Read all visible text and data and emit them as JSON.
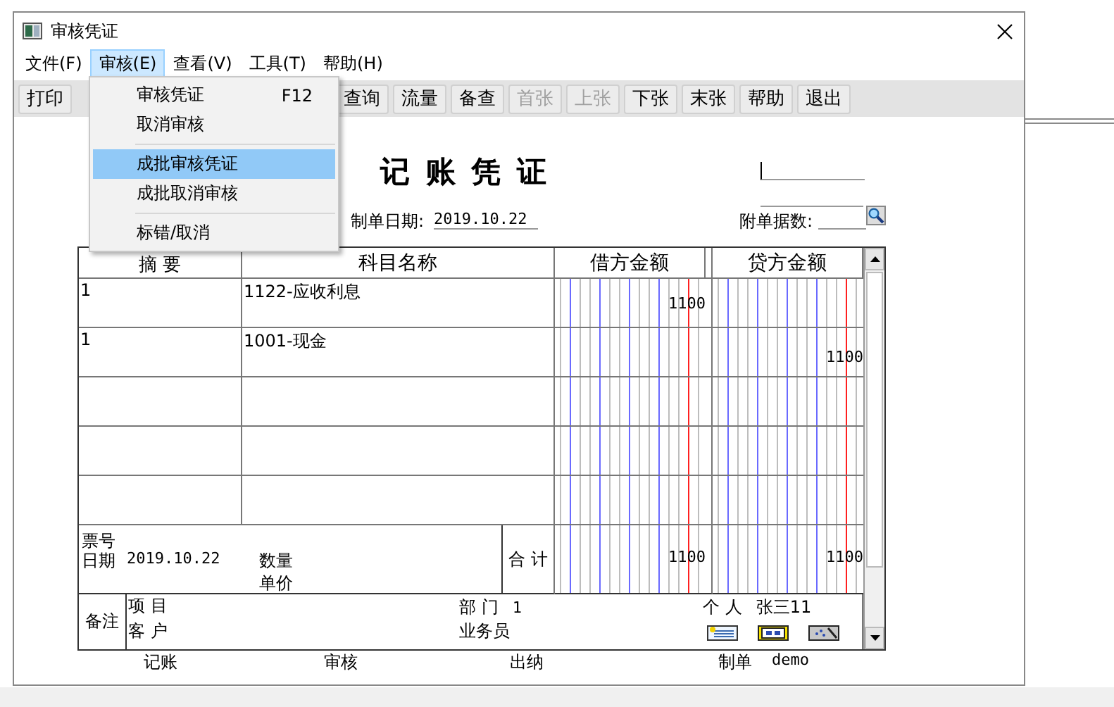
{
  "window": {
    "title": "审核凭证"
  },
  "menu": [
    {
      "label": "文件(F)",
      "selected": false
    },
    {
      "label": "审核(E)",
      "selected": true
    },
    {
      "label": "查看(V)",
      "selected": false
    },
    {
      "label": "工具(T)",
      "selected": false
    },
    {
      "label": "帮助(H)",
      "selected": false
    }
  ],
  "toolbar": {
    "before_menu": [
      {
        "label": "打印",
        "disabled": false
      }
    ],
    "after_menu": [
      {
        "label": "查询",
        "disabled": false
      },
      {
        "label": "流量",
        "disabled": false
      },
      {
        "label": "备查",
        "disabled": false
      },
      {
        "label": "首张",
        "disabled": true
      },
      {
        "label": "上张",
        "disabled": true
      },
      {
        "label": "下张",
        "disabled": false
      },
      {
        "label": "末张",
        "disabled": false
      },
      {
        "label": "帮助",
        "disabled": false
      },
      {
        "label": "退出",
        "disabled": false
      }
    ]
  },
  "dropdown": [
    {
      "label": "审核凭证",
      "shortcut": "F12",
      "selected": false,
      "separator_before": false
    },
    {
      "label": "取消审核",
      "selected": false,
      "separator_before": false
    },
    {
      "label": "成批审核凭证",
      "selected": true,
      "separator_before": true
    },
    {
      "label": "成批取消审核",
      "selected": false,
      "separator_before": false
    },
    {
      "label": "标错/取消",
      "selected": false,
      "separator_before": true
    }
  ],
  "voucher": {
    "title": "记 账 凭 证",
    "date_label": "制单日期:",
    "date": "2019.10.22",
    "attachments_label": "附单据数:",
    "columns": [
      "摘 要",
      "科目名称",
      "借方金额",
      "贷方金额"
    ],
    "rows": [
      {
        "summary": "1",
        "account": "1122-应收利息",
        "debit": "1100",
        "credit": ""
      },
      {
        "summary": "1",
        "account": "1001-现金",
        "debit": "",
        "credit": "1100"
      },
      {
        "summary": "",
        "account": "",
        "debit": "",
        "credit": ""
      },
      {
        "summary": "",
        "account": "",
        "debit": "",
        "credit": ""
      },
      {
        "summary": "",
        "account": "",
        "debit": "",
        "credit": ""
      }
    ],
    "footer": {
      "ticket_label": "票号",
      "date_label": "日期",
      "date": "2019.10.22",
      "quantity_label": "数量",
      "price_label": "单价",
      "total_label": "合 计",
      "debit_total": "1100",
      "credit_total": "1100"
    },
    "remarks": {
      "label": "备注",
      "project_label": "项 目",
      "customer_label": "客 户",
      "department_label": "部 门",
      "department": "1",
      "clerk_label": "业务员",
      "person_label": "个 人",
      "person": "张三11"
    },
    "signatures": [
      {
        "label": "记账"
      },
      {
        "label": "审核"
      },
      {
        "label": "出纳"
      },
      {
        "label": "制单",
        "value": "demo"
      }
    ]
  }
}
